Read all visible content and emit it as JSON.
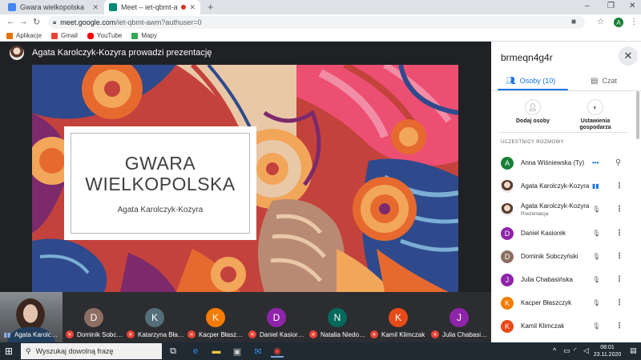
{
  "browser": {
    "tabs": [
      {
        "title": "Gwara wielkopolska",
        "favicon_color": "#4285f4",
        "active": false
      },
      {
        "title": "Meet – iet-qbmt-awm",
        "favicon_color": "#00897b",
        "active": true
      }
    ],
    "new_tab": "+",
    "window_controls": {
      "minimize": "–",
      "maximize": "❐",
      "close": "✕"
    },
    "url_host": "meet.google.com",
    "url_path": "/iet-qbmt-awm?authuser=0",
    "profile_initial": "A",
    "bookmarks": [
      {
        "label": "Aplikacje",
        "color": "#e37400"
      },
      {
        "label": "Gmail",
        "color": "#ea4335"
      },
      {
        "label": "YouTube",
        "color": "#ff0000"
      },
      {
        "label": "Mapy",
        "color": "#34a853"
      }
    ]
  },
  "meet": {
    "presenter_label": "Agata Karolczyk-Kozyra prowadzi prezentację",
    "slide": {
      "title_line1": "GWARA",
      "title_line2": "WIELKOPOLSKA",
      "subtitle": "Agata Karolczyk-Kozyra"
    }
  },
  "panel": {
    "meeting_code": "brmeqn4g4r",
    "close_label": "✕",
    "tabs": [
      {
        "label": "Osoby (10)",
        "icon": "people-icon"
      },
      {
        "label": "Czat",
        "icon": "chat-icon"
      }
    ],
    "actions": [
      {
        "label": "Dodaj osoby",
        "icon": "add-person-icon"
      },
      {
        "label_line1": "Ustawienia",
        "label_line2": "gospodarza",
        "icon": "toggle-icon"
      }
    ],
    "section_header": "UCZESTNICY ROZMOWY",
    "participants": [
      {
        "name": "Anna Wiśniewska (Ty)",
        "initial": "A",
        "color": "#188038",
        "status": "speaking-dots"
      },
      {
        "name": "Agata Karolczyk-Kozyra",
        "initial": "",
        "color": "#ffffff",
        "status": "mic-on"
      },
      {
        "name": "Agata Karolczyk-Kozyra",
        "sub": "Prezentacja",
        "initial": "",
        "color": "#ffffff",
        "status": "mic-off"
      },
      {
        "name": "Daniel Kasiorek",
        "initial": "D",
        "color": "#8e24aa",
        "status": "mic-off"
      },
      {
        "name": "Dominik Sobczyński",
        "initial": "D",
        "color": "#8d6e63",
        "status": "mic-off"
      },
      {
        "name": "Julia Chabasińska",
        "initial": "J",
        "color": "#8e24aa",
        "status": "mic-off"
      },
      {
        "name": "Kacper Błaszczyk",
        "initial": "K",
        "color": "#f57c00",
        "status": "mic-off"
      },
      {
        "name": "Kamil Klimczak",
        "initial": "K",
        "color": "#e64a19",
        "status": "mic-off"
      }
    ]
  },
  "filmstrip": [
    {
      "name": "Agata Karolc…",
      "initial": "",
      "color": "",
      "mic": "on"
    },
    {
      "name": "Dominik Sobc…",
      "initial": "D",
      "color": "#8d6e63",
      "mic": "off"
    },
    {
      "name": "Katarzyna Bła…",
      "initial": "K",
      "color": "#546e7a",
      "mic": "off"
    },
    {
      "name": "Kacper Błasz…",
      "initial": "K",
      "color": "#f57c00",
      "mic": "off"
    },
    {
      "name": "Daniel Kasior…",
      "initial": "D",
      "color": "#8e24aa",
      "mic": "off"
    },
    {
      "name": "Natalia Niedo…",
      "initial": "N",
      "color": "#00695c",
      "mic": "off"
    },
    {
      "name": "Kamil Klimczak",
      "initial": "K",
      "color": "#e64a19",
      "mic": "off"
    },
    {
      "name": "Julia Chabasi…",
      "initial": "J",
      "color": "#8e24aa",
      "mic": "off"
    }
  ],
  "taskbar": {
    "search_placeholder": "Wyszukaj dowolną frazę",
    "time": "08:01",
    "date": "23.11.2020"
  }
}
